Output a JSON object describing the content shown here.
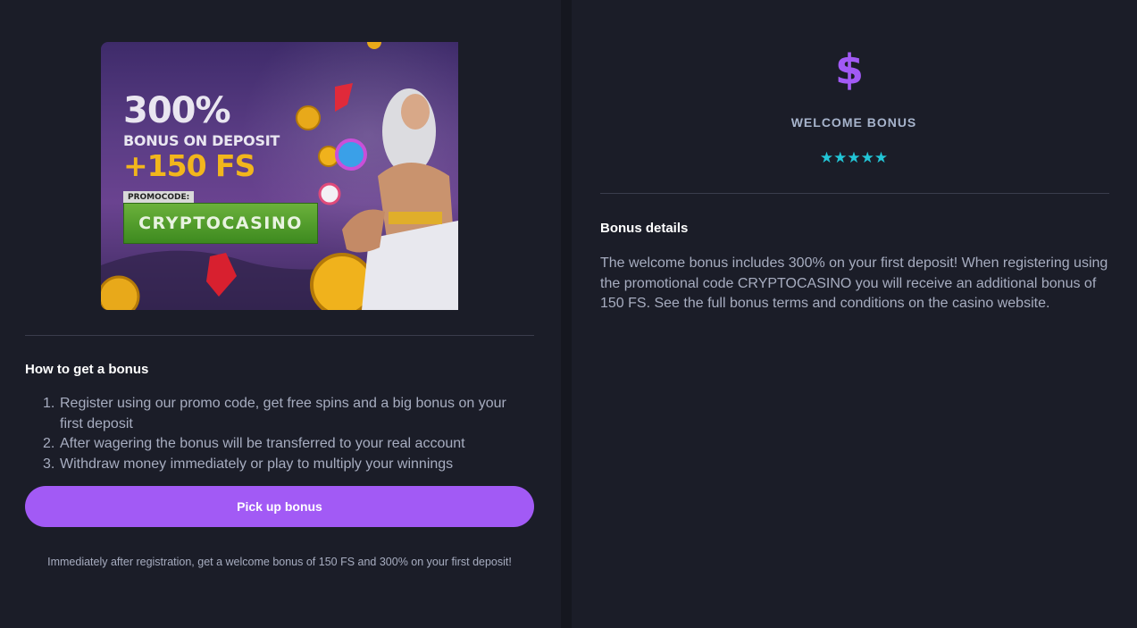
{
  "banner": {
    "headline": "300%",
    "subline": "BONUS ON DEPOSIT",
    "free_spins": "+150 FS",
    "promo_label": "PROMOCODE:",
    "promo_code": "CRYPTOCASINO"
  },
  "how_to": {
    "title": "How to get a bonus",
    "steps": [
      {
        "num": "1.",
        "text": "Register using our promo code, get free spins and a big bonus on your first deposit"
      },
      {
        "num": "2.",
        "text": "After wagering the bonus will be transferred to your real account"
      },
      {
        "num": "3.",
        "text": "Withdraw money immediately or play to multiply your winnings"
      }
    ]
  },
  "cta": {
    "label": "Pick up bonus"
  },
  "footnote": "Immediately after registration, get a welcome bonus of 150 FS and 300% on your first deposit!",
  "summary": {
    "icon": "dollar-icon",
    "icon_glyph": "$",
    "label": "WELCOME BONUS",
    "stars": "★★★★★",
    "rating": 5
  },
  "details": {
    "title": "Bonus details",
    "text": "The welcome bonus includes 300% on your first deposit! When registering using the promotional code CRYPTOCASINO you will receive an additional bonus of 150 FS. See the full bonus terms and conditions on the casino website."
  },
  "colors": {
    "accent": "#a25af5",
    "stars": "#22c5d6",
    "panel": "#1b1d28",
    "background": "#15171f"
  }
}
